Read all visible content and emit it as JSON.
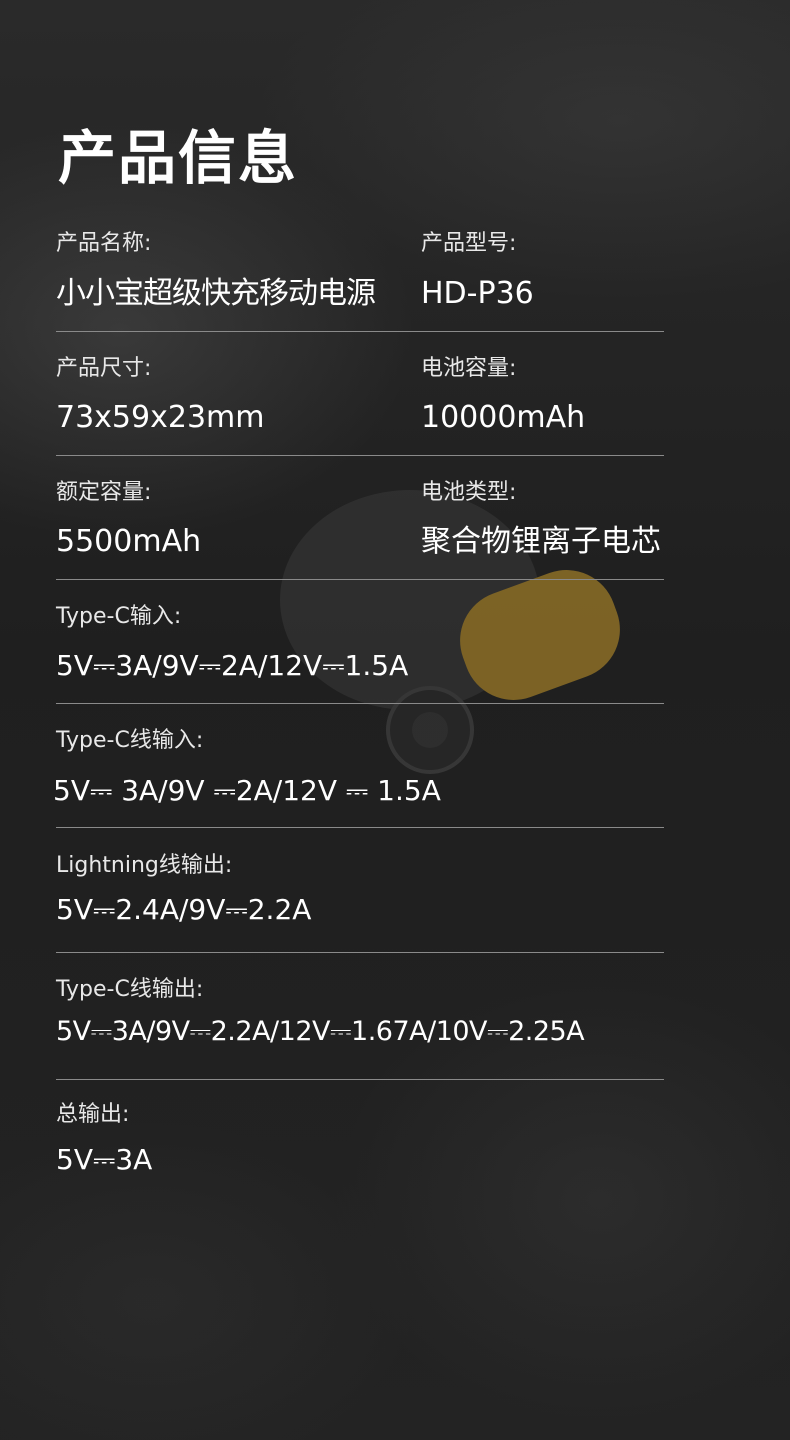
{
  "page_title": "产品信息",
  "colors": {
    "background": "#1d1d1d",
    "text": "#ffffff",
    "divider": "#8a8a8a",
    "device_accent": "#c89a2a"
  },
  "specs": {
    "product_name": {
      "label": "产品名称:",
      "value": "小小宝超级快充移动电源"
    },
    "product_model": {
      "label": "产品型号:",
      "value": "HD-P36"
    },
    "product_size": {
      "label": "产品尺寸:",
      "value": "73x59x23mm"
    },
    "battery_capacity": {
      "label": "电池容量:",
      "value": "10000mAh"
    },
    "rated_capacity": {
      "label": "额定容量:",
      "value": "5500mAh"
    },
    "battery_type": {
      "label": "电池类型:",
      "value": "聚合物锂离子电芯"
    },
    "typec_input": {
      "label": "Type-C输入:",
      "value": "5V⎓3A/9V⎓2A/12V⎓1.5A"
    },
    "typec_cable_input": {
      "label": "Type-C线输入:",
      "value": "5V⎓ 3A/9V ⎓2A/12V ⎓ 1.5A"
    },
    "lightning_cable_output": {
      "label": "Lightning线输出:",
      "value": "5V⎓2.4A/9V⎓2.2A"
    },
    "typec_cable_output": {
      "label": "Type-C线输出:",
      "value": "5V⎓3A/9V⎓2.2A/12V⎓1.67A/10V⎓2.25A"
    },
    "total_output": {
      "label": "总输出:",
      "value": "5V⎓3A"
    }
  }
}
